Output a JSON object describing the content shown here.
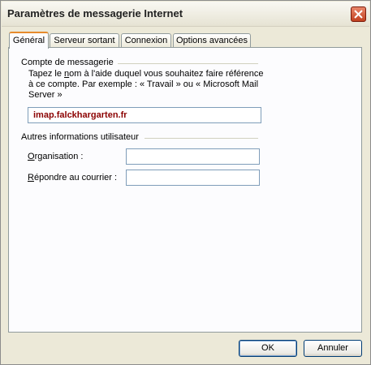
{
  "window": {
    "title": "Paramètres de messagerie Internet"
  },
  "tabs": [
    {
      "label": "Général",
      "active": true
    },
    {
      "label": "Serveur sortant"
    },
    {
      "label": "Connexion"
    },
    {
      "label": "Options avancées"
    }
  ],
  "account": {
    "group_label": "Compte de messagerie",
    "description_pre": "Tapez le ",
    "description_accel": "n",
    "description_post": "om à l'aide duquel vous souhaitez faire référence à ce compte. Par exemple : « Travail » ou « Microsoft Mail Server »",
    "name_value": "imap.falckhargarten.fr"
  },
  "user_info": {
    "group_label": "Autres informations utilisateur",
    "org_accel": "O",
    "org_rest": "rganisation :",
    "org_value": "",
    "reply_accel": "R",
    "reply_rest": "épondre au courrier :",
    "reply_value": ""
  },
  "buttons": {
    "ok": "OK",
    "cancel": "Annuler"
  }
}
